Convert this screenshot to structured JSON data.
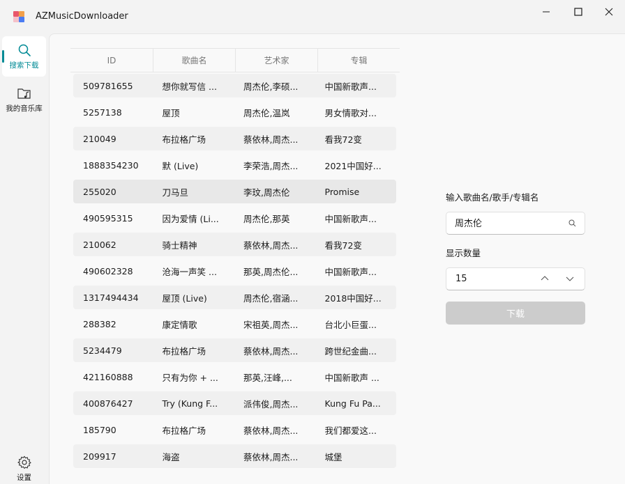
{
  "app": {
    "title": "AZMusicDownloader"
  },
  "nav": {
    "items": [
      {
        "label": "搜索下载",
        "icon": "search-icon"
      },
      {
        "label": "我的音乐库",
        "icon": "music-folder-icon"
      }
    ],
    "settings_label": "设置"
  },
  "table": {
    "headers": [
      "ID",
      "歌曲名",
      "艺术家",
      "专辑"
    ],
    "rows": [
      [
        "509781655",
        "想你就写信 ...",
        "周杰伦,李硕...",
        "中国新歌声..."
      ],
      [
        "5257138",
        "屋顶",
        "周杰伦,温岚",
        "男女情歌对..."
      ],
      [
        "210049",
        "布拉格广场",
        "蔡依林,周杰...",
        "看我72变"
      ],
      [
        "1888354230",
        "默 (Live)",
        "李荣浩,周杰...",
        "2021中国好..."
      ],
      [
        "255020",
        "刀马旦",
        "李玟,周杰伦",
        "Promise"
      ],
      [
        "490595315",
        "因为爱情 (Li...",
        "周杰伦,那英",
        "中国新歌声..."
      ],
      [
        "210062",
        "骑士精神",
        "蔡依林,周杰...",
        "看我72变"
      ],
      [
        "490602328",
        "沧海一声笑 ...",
        "那英,周杰伦...",
        "中国新歌声..."
      ],
      [
        "1317494434",
        "屋顶 (Live)",
        "周杰伦,宿涵...",
        "2018中国好..."
      ],
      [
        "288382",
        "康定情歌",
        "宋祖英,周杰...",
        "台北小巨蛋..."
      ],
      [
        "5234479",
        "布拉格广场",
        "蔡依林,周杰...",
        "跨世纪金曲..."
      ],
      [
        "421160888",
        "只有为你 + ...",
        "那英,汪峰,...",
        "中国新歌声 ..."
      ],
      [
        "400876427",
        "Try (Kung F...",
        "派伟俊,周杰...",
        "Kung Fu Pa..."
      ],
      [
        "185790",
        "布拉格广场",
        "蔡依林,周杰...",
        "我们都爱这..."
      ],
      [
        "209917",
        "海盗",
        "蔡依林,周杰...",
        "城堡"
      ]
    ]
  },
  "panel": {
    "search_label": "输入歌曲名/歌手/专辑名",
    "search_value": "周杰伦",
    "count_label": "显示数量",
    "count_value": "15",
    "download_label": "下载"
  },
  "colors": {
    "accent": "#008a95",
    "disabled_button": "#cccccc"
  }
}
